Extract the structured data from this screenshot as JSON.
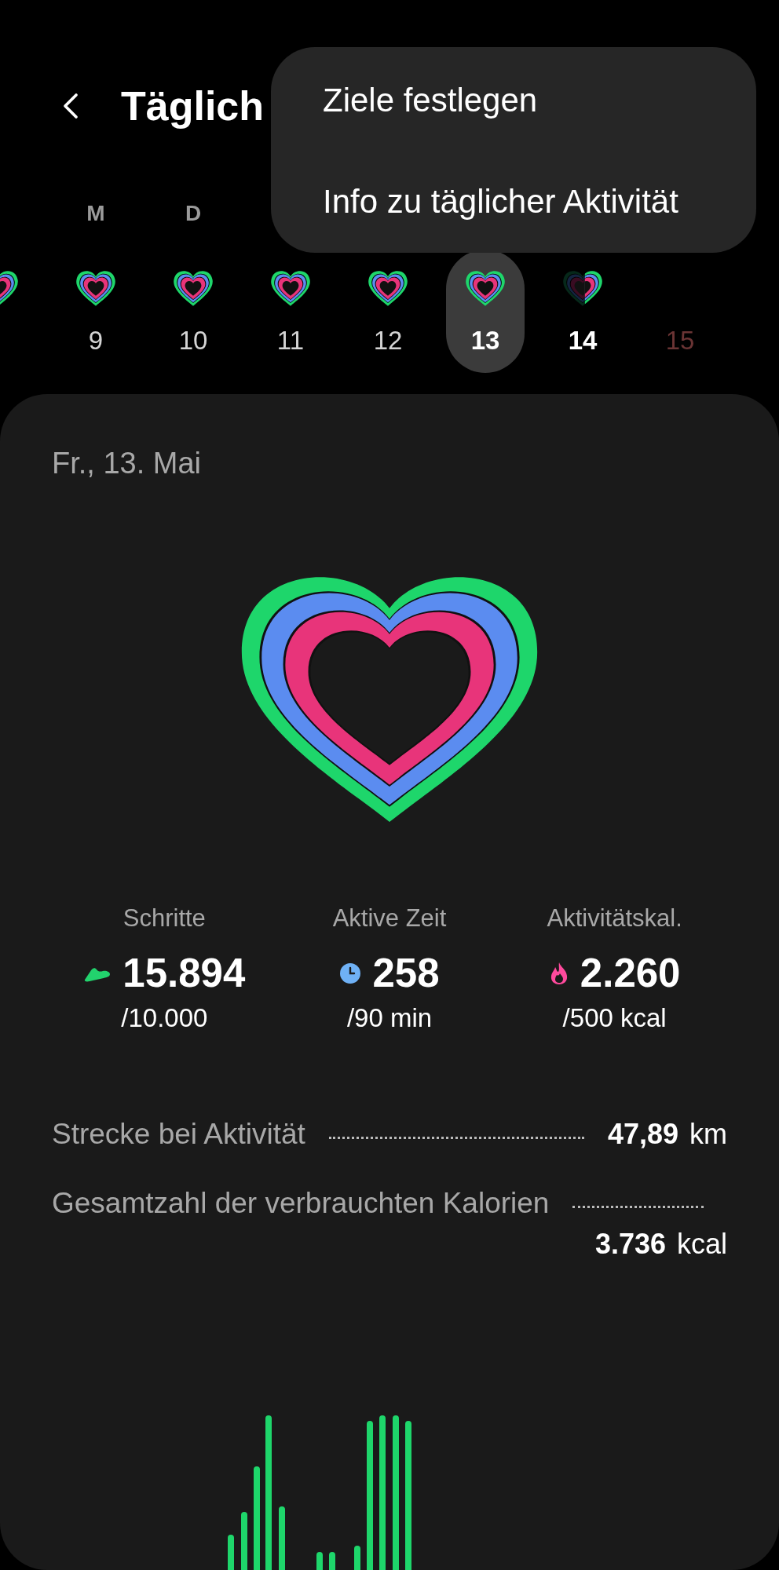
{
  "header": {
    "title": "Täglich"
  },
  "menu": {
    "items": [
      {
        "label": "Ziele festlegen"
      },
      {
        "label": "Info zu täglicher Aktivität"
      }
    ]
  },
  "days": [
    {
      "goal_met": true,
      "future": false,
      "selected": false
    },
    {
      "weekday": "M",
      "label": "9",
      "goal_met": true,
      "future": false,
      "today": false,
      "selected": false
    },
    {
      "weekday": "D",
      "label": "10",
      "goal_met": true,
      "future": false,
      "today": false,
      "selected": false
    },
    {
      "label": "11",
      "goal_met": true,
      "future": false,
      "today": false,
      "selected": false
    },
    {
      "label": "12",
      "goal_met": true,
      "future": false,
      "today": false,
      "selected": false
    },
    {
      "label": "13",
      "goal_met": true,
      "future": false,
      "selected": true
    },
    {
      "label": "14",
      "goal_met": false,
      "future": false,
      "today": true,
      "selected": false
    },
    {
      "label": "15",
      "future": true,
      "selected": false
    }
  ],
  "card": {
    "date": "Fr., 13. Mai",
    "stats": [
      {
        "kind": "steps",
        "label": "Schritte",
        "value": "15.894",
        "goal": "/10.000"
      },
      {
        "kind": "time",
        "label": "Aktive Zeit",
        "value": "258",
        "goal": "/90 min"
      },
      {
        "kind": "calories",
        "label": "Aktivitätskal.",
        "value": "2.260",
        "goal": "/500 kcal"
      }
    ],
    "rows": [
      {
        "kind": "inline",
        "label": "Strecke bei Aktivität",
        "value": "47,89",
        "unit": "km"
      },
      {
        "kind": "wrapped",
        "label": "Gesamtzahl der verbrauchten Kalorien",
        "value": "3.736",
        "unit": "kcal"
      }
    ]
  }
}
